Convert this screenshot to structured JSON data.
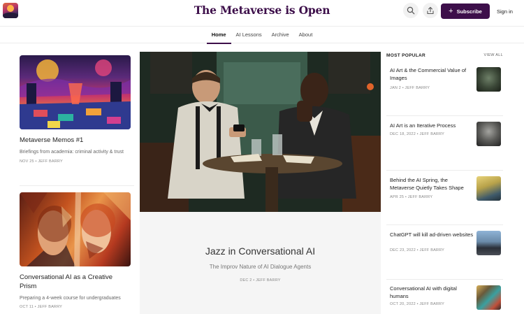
{
  "header": {
    "title": "The Metaverse is Open",
    "subscribe_label": "Subscribe",
    "signin_label": "Sign in"
  },
  "nav": {
    "items": [
      {
        "label": "Home",
        "active": true
      },
      {
        "label": "AI Lessons",
        "active": false
      },
      {
        "label": "Archive",
        "active": false
      },
      {
        "label": "About",
        "active": false
      }
    ]
  },
  "left_posts": [
    {
      "title": "Metaverse Memos #1",
      "subtitle": "Briefings from academia: criminal activity & trust",
      "meta": "NOV 25 • JEFF BARRY"
    },
    {
      "title": "Conversational AI as a Creative Prism",
      "subtitle": "Preparing a 4-week course for undergraduates",
      "meta": "OCT 11 • JEFF BARRY"
    }
  ],
  "featured": {
    "title": "Jazz in Conversational AI",
    "subtitle": "The Improv Nature of AI Dialogue Agents",
    "meta": "DEC 2 • JEFF BARRY"
  },
  "popular": {
    "label": "MOST POPULAR",
    "view_all": "VIEW ALL",
    "items": [
      {
        "title": "AI Art & the Commercial Value of Images",
        "meta": "JAN 2 • JEFF BARRY"
      },
      {
        "title": "AI Art is an Iterative Process",
        "meta": "DEC 18, 2022 • JEFF BARRY"
      },
      {
        "title": "Behind the AI Spring, the Metaverse Quietly Takes Shape",
        "meta": "APR 25 • JEFF BARRY"
      },
      {
        "title": "ChatGPT will kill ad-driven websites",
        "meta": "DEC 23, 2022 • JEFF BARRY"
      },
      {
        "title": "Conversational AI with digital humans",
        "meta": "OCT 20, 2022 • JEFF BARRY"
      }
    ]
  },
  "icons": {
    "search": "search-icon",
    "share": "share-icon",
    "plus": "plus-icon"
  },
  "colors": {
    "brand": "#3d0f4a",
    "text": "#222222",
    "muted": "#888888"
  }
}
